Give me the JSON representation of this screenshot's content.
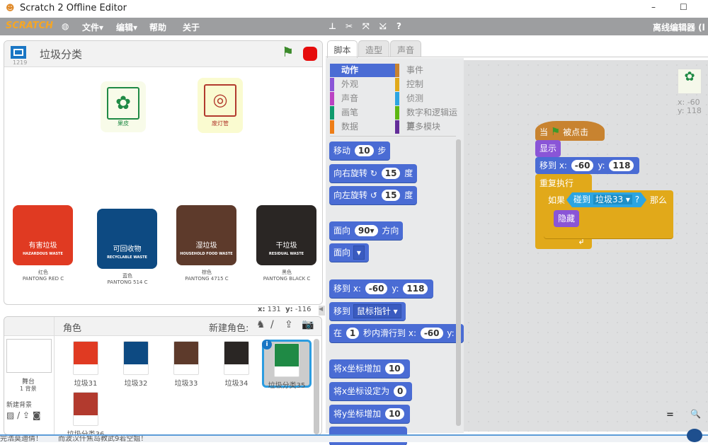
{
  "window": {
    "title": "Scratch 2 Offline Editor",
    "minimize": "–",
    "maximize": "☐"
  },
  "menubar": {
    "logo": "SCRATCH",
    "file": "文件▾",
    "edit": "编辑▾",
    "help": "帮助",
    "about": "关于",
    "right_label": "离线编辑器 (l"
  },
  "stage": {
    "project_title": "垃圾分类",
    "version": "1219",
    "coord_x_label": "x:",
    "coord_x": "131",
    "coord_y_label": "y:",
    "coord_y": "-116",
    "top_signs": [
      {
        "label": "果皮"
      },
      {
        "label": "废灯管"
      }
    ],
    "signs": [
      {
        "cn": "有害垃圾",
        "en": "HAZARDOUS WASTE",
        "color_name": "红色",
        "pantone": "PANTONG RED C",
        "color": "#e03a22"
      },
      {
        "cn": "可回收物",
        "en": "RECYCLABLE WASTE",
        "color_name": "蓝色",
        "pantone": "PANTONG 514 C",
        "color": "#0d4a82"
      },
      {
        "cn": "湿垃圾",
        "en": "HOUSEHOLD FOOD WASTE",
        "color_name": "棕色",
        "pantone": "PANTONG 4715 C",
        "color": "#5d3a2b"
      },
      {
        "cn": "干垃圾",
        "en": "RESIDUAL WASTE",
        "color_name": "黑色",
        "pantone": "PANTONG BLACK C",
        "color": "#2a2624"
      }
    ]
  },
  "tabs": [
    {
      "label": "脚本"
    },
    {
      "label": "造型"
    },
    {
      "label": "声音"
    }
  ],
  "categories": [
    {
      "label": "动作",
      "color": "#4a6cd4"
    },
    {
      "label": "事件",
      "color": "#c88330"
    },
    {
      "label": "外观",
      "color": "#8a55d7"
    },
    {
      "label": "控制",
      "color": "#e1a91a"
    },
    {
      "label": "声音",
      "color": "#bb42c3"
    },
    {
      "label": "侦测",
      "color": "#2ca5e2"
    },
    {
      "label": "画笔",
      "color": "#0e9a6c"
    },
    {
      "label": "数字和逻辑运算",
      "color": "#5cb712"
    },
    {
      "label": "数据",
      "color": "#ee7d16"
    },
    {
      "label": "更多模块",
      "color": "#632d99"
    }
  ],
  "palette": {
    "move": {
      "a": "移动",
      "n": "10",
      "b": "步"
    },
    "turn_right": {
      "a": "向右旋转",
      "icon": "↻",
      "n": "15",
      "b": "度"
    },
    "turn_left": {
      "a": "向左旋转",
      "icon": "↺",
      "n": "15",
      "b": "度"
    },
    "point_dir": {
      "a": "面向",
      "n": "90▾",
      "b": "方向"
    },
    "point_towards": {
      "a": "面向",
      "dd": "▾"
    },
    "goto_xy": {
      "a": "移到 x:",
      "x": "-60",
      "b": "y:",
      "y": "118"
    },
    "goto": {
      "a": "移到",
      "dd": "鼠标指针 ▾"
    },
    "glide": {
      "a": "在",
      "n": "1",
      "b": "秒内滑行到 x:",
      "x": "-60",
      "c": "y:"
    },
    "change_x": {
      "a": "将x坐标增加",
      "n": "10"
    },
    "set_x": {
      "a": "将x坐标设定为",
      "n": "0"
    },
    "change_y": {
      "a": "将y坐标增加",
      "n": "10"
    }
  },
  "script": {
    "sprite_x": "x: -60",
    "sprite_y": "y: 118",
    "hat": {
      "a": "当",
      "b": "被点击"
    },
    "show": "显示",
    "goto": {
      "a": "移到 x:",
      "x": "-60",
      "b": "y:",
      "y": "118"
    },
    "forever": "重复执行",
    "if": {
      "a": "如果",
      "touch": "碰到",
      "dd": "垃圾33 ▾",
      "q": "?",
      "then": "那么"
    },
    "hide": "隐藏"
  },
  "zoom": {
    "reset": "=",
    "zoom_in": "🔍"
  },
  "sprites": {
    "header": "角色",
    "new_sprite": "新建角色:",
    "stage_label": "舞台",
    "backdrops": "1 背景",
    "new_backdrop": "新建背景",
    "items": [
      {
        "name": "垃圾31",
        "color": "#e03a22"
      },
      {
        "name": "垃圾32",
        "color": "#0d4a82"
      },
      {
        "name": "垃圾33",
        "color": "#5d3a2b"
      },
      {
        "name": "垃圾34",
        "color": "#2a2624"
      },
      {
        "name": "垃圾分类35",
        "color": "#1f8a45",
        "selected": true
      },
      {
        "name": "垃圾分类36",
        "color": "#b23a2e"
      }
    ]
  },
  "bottom": {
    "left": "完浩莫迪倩！",
    "right": "而波汉仟焦岛教武9若空姐！"
  }
}
